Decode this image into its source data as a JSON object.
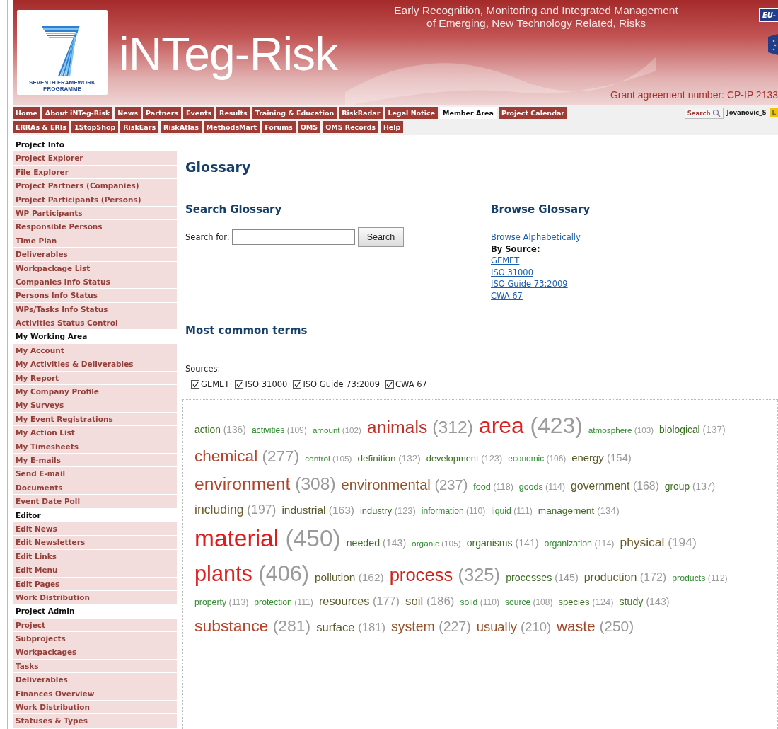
{
  "banner": {
    "tagline_1": "Early Recognition, Monitoring and Integrated Management",
    "tagline_2": "of Emerging, New Technology Related, Risks",
    "logo_caption_1": "SEVENTH FRAMEWORK",
    "logo_caption_2": "PROGRAMME",
    "site_title": "iNTeg-Risk",
    "grant": "Grant agreement number: CP-IP 2133",
    "eu_badge": "EU-"
  },
  "nav_rows": [
    [
      {
        "label": "Home",
        "selected": false
      },
      {
        "label": "About iNTeg-Risk",
        "selected": false
      },
      {
        "label": "News",
        "selected": false
      },
      {
        "label": "Partners",
        "selected": false
      },
      {
        "label": "Events",
        "selected": false
      },
      {
        "label": "Results",
        "selected": false
      },
      {
        "label": "Training & Education",
        "selected": false
      },
      {
        "label": "RiskRadar",
        "selected": false
      },
      {
        "label": "Legal Notice",
        "selected": false
      },
      {
        "label": "Member Area",
        "selected": true
      },
      {
        "label": "Project Calendar",
        "selected": false
      }
    ],
    [
      {
        "label": "ERRAs & ERIs",
        "selected": false
      },
      {
        "label": "1StopShop",
        "selected": false
      },
      {
        "label": "RiskEars",
        "selected": false
      },
      {
        "label": "RiskAtlas",
        "selected": false
      },
      {
        "label": "MethodsMart",
        "selected": false
      },
      {
        "label": "Forums",
        "selected": false
      },
      {
        "label": "QMS",
        "selected": false
      },
      {
        "label": "QMS Records",
        "selected": false
      },
      {
        "label": "Help",
        "selected": false
      }
    ]
  ],
  "user_bar": {
    "search_button": "Search",
    "username": "Jovanovic_S",
    "badge": "L"
  },
  "sidebar": [
    {
      "kind": "header",
      "label": "Project Info"
    },
    {
      "kind": "link",
      "label": "Project Explorer"
    },
    {
      "kind": "link",
      "label": "File Explorer"
    },
    {
      "kind": "link",
      "label": "Project Partners (Companies)"
    },
    {
      "kind": "link",
      "label": "Project Participants (Persons)"
    },
    {
      "kind": "link",
      "label": "WP Participants"
    },
    {
      "kind": "link",
      "label": "Responsible Persons"
    },
    {
      "kind": "link",
      "label": "Time Plan"
    },
    {
      "kind": "link",
      "label": "Deliverables"
    },
    {
      "kind": "link",
      "label": "Workpackage List"
    },
    {
      "kind": "link",
      "label": "Companies Info Status"
    },
    {
      "kind": "link",
      "label": "Persons Info Status"
    },
    {
      "kind": "link",
      "label": "WPs/Tasks Info Status"
    },
    {
      "kind": "link",
      "label": "Activities Status Control"
    },
    {
      "kind": "header",
      "label": "My Working Area"
    },
    {
      "kind": "link",
      "label": "My Account"
    },
    {
      "kind": "link",
      "label": "My Activities & Deliverables"
    },
    {
      "kind": "link",
      "label": "My Report"
    },
    {
      "kind": "link",
      "label": "My Company Profile"
    },
    {
      "kind": "link",
      "label": "My Surveys"
    },
    {
      "kind": "link",
      "label": "My Event Registrations"
    },
    {
      "kind": "link",
      "label": "My Action List"
    },
    {
      "kind": "link",
      "label": "My Timesheets"
    },
    {
      "kind": "link",
      "label": "My E-mails"
    },
    {
      "kind": "link",
      "label": "Send E-mail"
    },
    {
      "kind": "link",
      "label": "Documents"
    },
    {
      "kind": "link",
      "label": "Event Date Poll"
    },
    {
      "kind": "header",
      "label": "Editor"
    },
    {
      "kind": "link",
      "label": "Edit News"
    },
    {
      "kind": "link",
      "label": "Edit Newsletters"
    },
    {
      "kind": "link",
      "label": "Edit Links"
    },
    {
      "kind": "link",
      "label": "Edit Menu"
    },
    {
      "kind": "link",
      "label": "Edit Pages"
    },
    {
      "kind": "link",
      "label": "Work Distribution"
    },
    {
      "kind": "header",
      "label": "Project Admin"
    },
    {
      "kind": "link",
      "label": "Project"
    },
    {
      "kind": "link",
      "label": "Subprojects"
    },
    {
      "kind": "link",
      "label": "Workpackages"
    },
    {
      "kind": "link",
      "label": "Tasks"
    },
    {
      "kind": "link",
      "label": "Deliverables"
    },
    {
      "kind": "link",
      "label": "Finances Overview"
    },
    {
      "kind": "link",
      "label": "Work Distribution"
    },
    {
      "kind": "link",
      "label": "Statuses & Types"
    }
  ],
  "page_title": "Glossary",
  "search": {
    "heading": "Search Glossary",
    "label": "Search for:",
    "button": "Search"
  },
  "browse": {
    "heading": "Browse Glossary",
    "alphabetical_link": "Browse Alphabetically",
    "by_source_label": "By Source:",
    "source_links": [
      "GEMET",
      "ISO 31000",
      "ISO Guide 73:2009",
      "CWA 67"
    ]
  },
  "terms": {
    "heading": "Most common terms",
    "sources_label": "Sources:",
    "sources": [
      {
        "label": "GEMET",
        "checked": true
      },
      {
        "label": "ISO 31000",
        "checked": true
      },
      {
        "label": "ISO Guide 73:2009",
        "checked": true
      },
      {
        "label": "CWA 67",
        "checked": true
      }
    ],
    "cloud": [
      {
        "term": "action",
        "count": "(136)",
        "color": "#3c6e23"
      },
      {
        "term": "activities",
        "count": "(109)",
        "color": "#2e8b2e"
      },
      {
        "term": "amount",
        "count": "(102)",
        "color": "#2e8b2e"
      },
      {
        "term": "animals",
        "count": "(312)",
        "color": "#c0302a"
      },
      {
        "term": "area",
        "count": "(423)",
        "color": "#dd1e1e"
      },
      {
        "term": "atmosphere",
        "count": "(103)",
        "color": "#2e8b2e"
      },
      {
        "term": "biological",
        "count": "(137)",
        "color": "#3c6e23"
      },
      {
        "term": "chemical",
        "count": "(277)",
        "color": "#b5432a"
      },
      {
        "term": "control",
        "count": "(105)",
        "color": "#2e8b2e"
      },
      {
        "term": "definition",
        "count": "(132)",
        "color": "#3c6e23"
      },
      {
        "term": "development",
        "count": "(123)",
        "color": "#3c6e23"
      },
      {
        "term": "economic",
        "count": "(106)",
        "color": "#2e8b2e"
      },
      {
        "term": "energy",
        "count": "(154)",
        "color": "#5a5a2a"
      },
      {
        "term": "environment",
        "count": "(308)",
        "color": "#b5432a"
      },
      {
        "term": "environmental",
        "count": "(237)",
        "color": "#94512a"
      },
      {
        "term": "food",
        "count": "(118)",
        "color": "#2e8b2e"
      },
      {
        "term": "goods",
        "count": "(114)",
        "color": "#2e8b2e"
      },
      {
        "term": "government",
        "count": "(168)",
        "color": "#5a5a2a"
      },
      {
        "term": "group",
        "count": "(137)",
        "color": "#3c6e23"
      },
      {
        "term": "including",
        "count": "(197)",
        "color": "#6b5a2a"
      },
      {
        "term": "industrial",
        "count": "(163)",
        "color": "#5a5a2a"
      },
      {
        "term": "industry",
        "count": "(123)",
        "color": "#3c6e23"
      },
      {
        "term": "information",
        "count": "(110)",
        "color": "#2e8b2e"
      },
      {
        "term": "liquid",
        "count": "(111)",
        "color": "#2e8b2e"
      },
      {
        "term": "management",
        "count": "(134)",
        "color": "#3c6e23"
      },
      {
        "term": "material",
        "count": "(450)",
        "color": "#e01b1b"
      },
      {
        "term": "needed",
        "count": "(143)",
        "color": "#3c6e23"
      },
      {
        "term": "organic",
        "count": "(105)",
        "color": "#2e8b2e"
      },
      {
        "term": "organisms",
        "count": "(141)",
        "color": "#3c6e23"
      },
      {
        "term": "organization",
        "count": "(114)",
        "color": "#2e8b2e"
      },
      {
        "term": "physical",
        "count": "(194)",
        "color": "#6b5a2a"
      },
      {
        "term": "plants",
        "count": "(406)",
        "color": "#dd1e1e"
      },
      {
        "term": "pollution",
        "count": "(162)",
        "color": "#5a5a2a"
      },
      {
        "term": "process",
        "count": "(325)",
        "color": "#c8261f"
      },
      {
        "term": "processes",
        "count": "(145)",
        "color": "#3c6e23"
      },
      {
        "term": "production",
        "count": "(172)",
        "color": "#5a5a2a"
      },
      {
        "term": "products",
        "count": "(112)",
        "color": "#2e8b2e"
      },
      {
        "term": "property",
        "count": "(113)",
        "color": "#2e8b2e"
      },
      {
        "term": "protection",
        "count": "(111)",
        "color": "#2e8b2e"
      },
      {
        "term": "resources",
        "count": "(177)",
        "color": "#5a5a2a"
      },
      {
        "term": "soil",
        "count": "(186)",
        "color": "#6b5a2a"
      },
      {
        "term": "solid",
        "count": "(110)",
        "color": "#2e8b2e"
      },
      {
        "term": "source",
        "count": "(108)",
        "color": "#2e8b2e"
      },
      {
        "term": "species",
        "count": "(124)",
        "color": "#3c6e23"
      },
      {
        "term": "study",
        "count": "(143)",
        "color": "#3c6e23"
      },
      {
        "term": "substance",
        "count": "(281)",
        "color": "#b5432a"
      },
      {
        "term": "surface",
        "count": "(181)",
        "color": "#5a5a2a"
      },
      {
        "term": "system",
        "count": "(227)",
        "color": "#94512a"
      },
      {
        "term": "usually",
        "count": "(210)",
        "color": "#94512a"
      },
      {
        "term": "waste",
        "count": "(250)",
        "color": "#a0472a"
      }
    ]
  }
}
